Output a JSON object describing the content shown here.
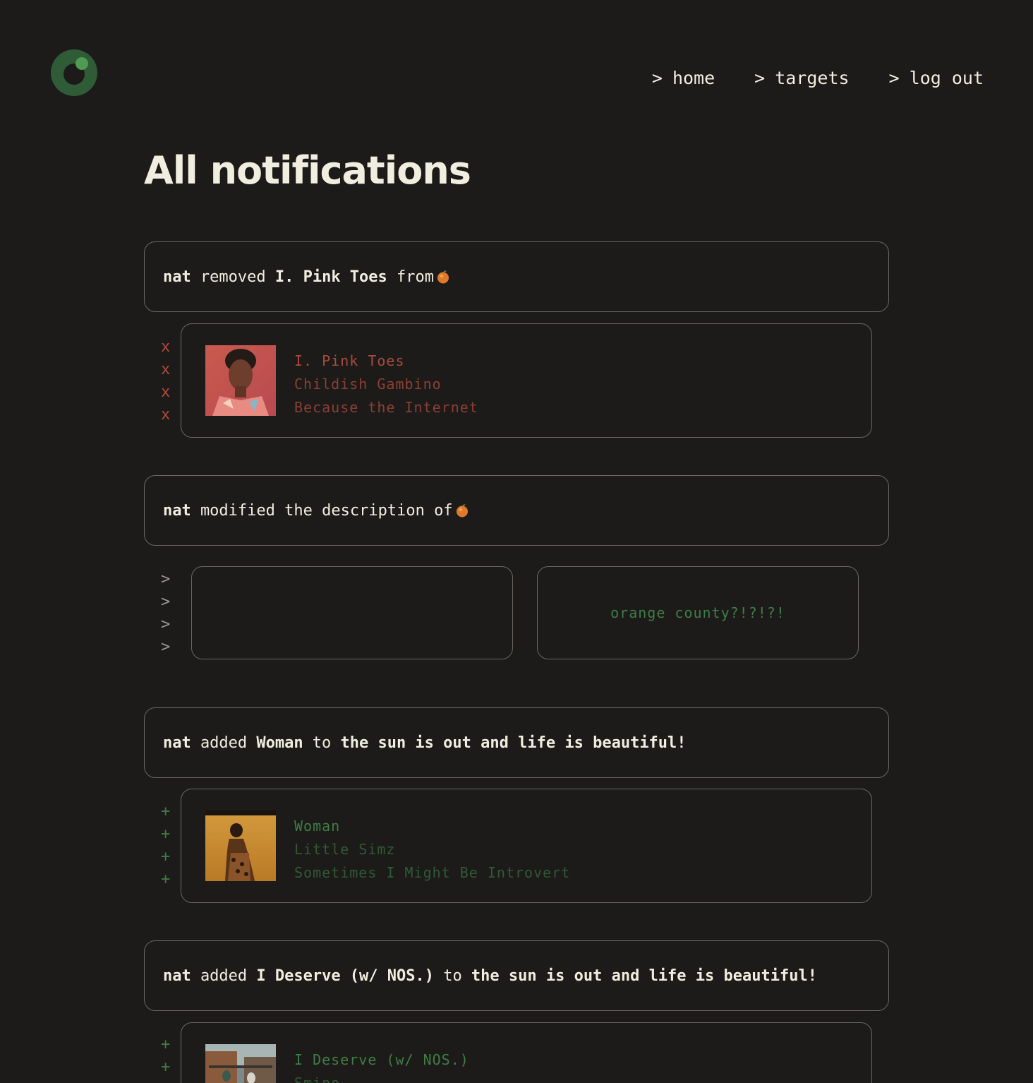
{
  "nav": {
    "caret": ">",
    "home": "home",
    "targets": "targets",
    "logout": "log out"
  },
  "page_title": "All notifications",
  "colors": {
    "background": "#1c1b19",
    "accent_green": "#3f7d45",
    "removed_red": "#a84a3c"
  },
  "notifications": [
    {
      "user": "nat",
      "action": "removed",
      "track": "I. Pink Toes",
      "preposition": "from",
      "target_icon": "orange-emoji-icon",
      "marker": "x",
      "item": {
        "title": "I. Pink Toes",
        "artist": "Childish Gambino",
        "album": "Because the Internet"
      }
    },
    {
      "user": "nat",
      "action": "modified the description of",
      "target_icon": "orange-emoji-icon",
      "marker": ">",
      "old_description": "",
      "new_description": "orange county?!?!?!"
    },
    {
      "user": "nat",
      "action": "added",
      "track": "Woman",
      "preposition": "to",
      "target": "the sun is out and life is beautiful!",
      "marker": "+",
      "item": {
        "title": "Woman",
        "artist": "Little Simz",
        "album": "Sometimes I Might Be Introvert"
      }
    },
    {
      "user": "nat",
      "action": "added",
      "track": "I Deserve (w/ NOS.)",
      "preposition": "to",
      "target": "the sun is out and life is beautiful!",
      "marker": "+",
      "item": {
        "title": "I Deserve (w/ NOS.)",
        "artist": "Smino"
      }
    }
  ]
}
